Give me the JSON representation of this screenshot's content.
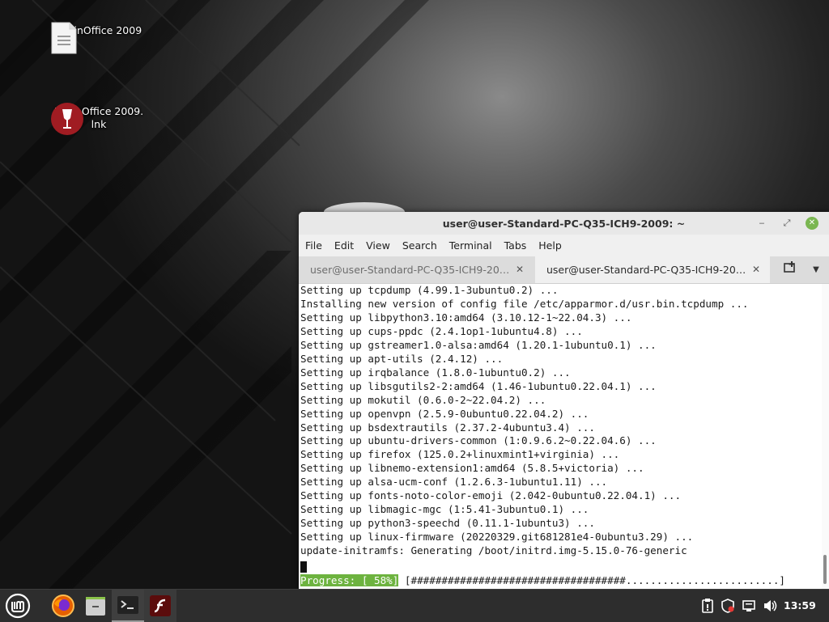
{
  "desktop": {
    "icons": [
      {
        "label": "KevinOffice 2009",
        "icon": "document-icon"
      },
      {
        "label": "KevinOffice 2009.\nlnk",
        "icon": "wine-glass-icon"
      }
    ]
  },
  "terminal": {
    "title": "user@user-Standard-PC-Q35-ICH9-2009: ~",
    "menu": [
      "File",
      "Edit",
      "View",
      "Search",
      "Terminal",
      "Tabs",
      "Help"
    ],
    "tabs": [
      {
        "label": "user@user-Standard-PC-Q35-ICH9-200…",
        "close": "✕",
        "active": false
      },
      {
        "label": "user@user-Standard-PC-Q35-ICH9-200…",
        "close": "✕",
        "active": true
      }
    ],
    "lines": [
      "Setting up tcpdump (4.99.1-3ubuntu0.2) ...",
      "Installing new version of config file /etc/apparmor.d/usr.bin.tcpdump ...",
      "Setting up libpython3.10:amd64 (3.10.12-1~22.04.3) ...",
      "Setting up cups-ppdc (2.4.1op1-1ubuntu4.8) ...",
      "Setting up gstreamer1.0-alsa:amd64 (1.20.1-1ubuntu0.1) ...",
      "Setting up apt-utils (2.4.12) ...",
      "Setting up irqbalance (1.8.0-1ubuntu0.2) ...",
      "Setting up libsgutils2-2:amd64 (1.46-1ubuntu0.22.04.1) ...",
      "Setting up mokutil (0.6.0-2~22.04.2) ...",
      "Setting up openvpn (2.5.9-0ubuntu0.22.04.2) ...",
      "Setting up bsdextrautils (2.37.2-4ubuntu3.4) ...",
      "Setting up ubuntu-drivers-common (1:0.9.6.2~0.22.04.6) ...",
      "Setting up firefox (125.0.2+linuxmint1+virginia) ...",
      "Setting up libnemo-extension1:amd64 (5.8.5+victoria) ...",
      "Setting up alsa-ucm-conf (1.2.6.3-1ubuntu1.11) ...",
      "Setting up fonts-noto-color-emoji (2.042-0ubuntu0.22.04.1) ...",
      "Setting up libmagic-mgc (1:5.41-3ubuntu0.1) ...",
      "Setting up python3-speechd (0.11.1-1ubuntu3) ...",
      "Setting up linux-firmware (20220329.git681281e4-0ubuntu3.29) ...",
      "update-initramfs: Generating /boot/initrd.img-5.15.0-76-generic"
    ],
    "progress": {
      "label": "Progress: [ 58%]",
      "bar": " [###################################.........................]",
      "percent": 58
    }
  },
  "taskbar": {
    "apps": [
      "mint-menu-icon",
      "firefox-icon",
      "files-icon",
      "terminal-icon",
      "flash-icon"
    ],
    "tray": [
      "clipboard-icon",
      "update-shield-icon",
      "network-icon",
      "volume-icon"
    ],
    "clock": "13:59"
  }
}
